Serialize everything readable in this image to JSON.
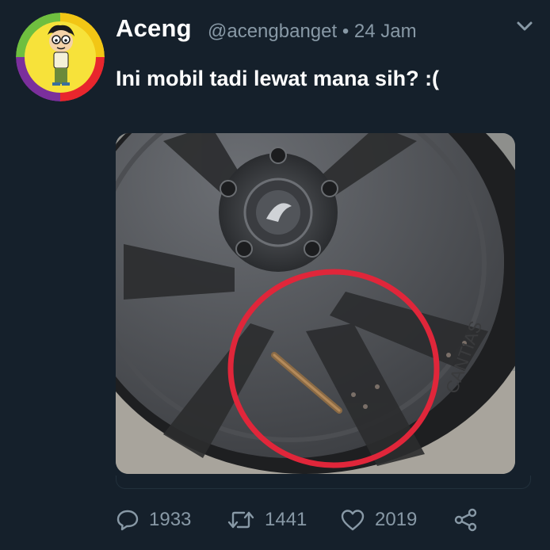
{
  "tweet": {
    "display_name": "Aceng",
    "meta": "@acengbanget • 24 Jam",
    "text": "Ini mobil tadi lewat mana sih? :(",
    "media_alt_icon": "car-wheel-photo"
  },
  "actions": {
    "replies": "1933",
    "retweets": "1441",
    "likes": "2019"
  },
  "colors": {
    "background": "#15202b",
    "muted": "#8899a6",
    "highlight_circle": "#e0263a"
  }
}
